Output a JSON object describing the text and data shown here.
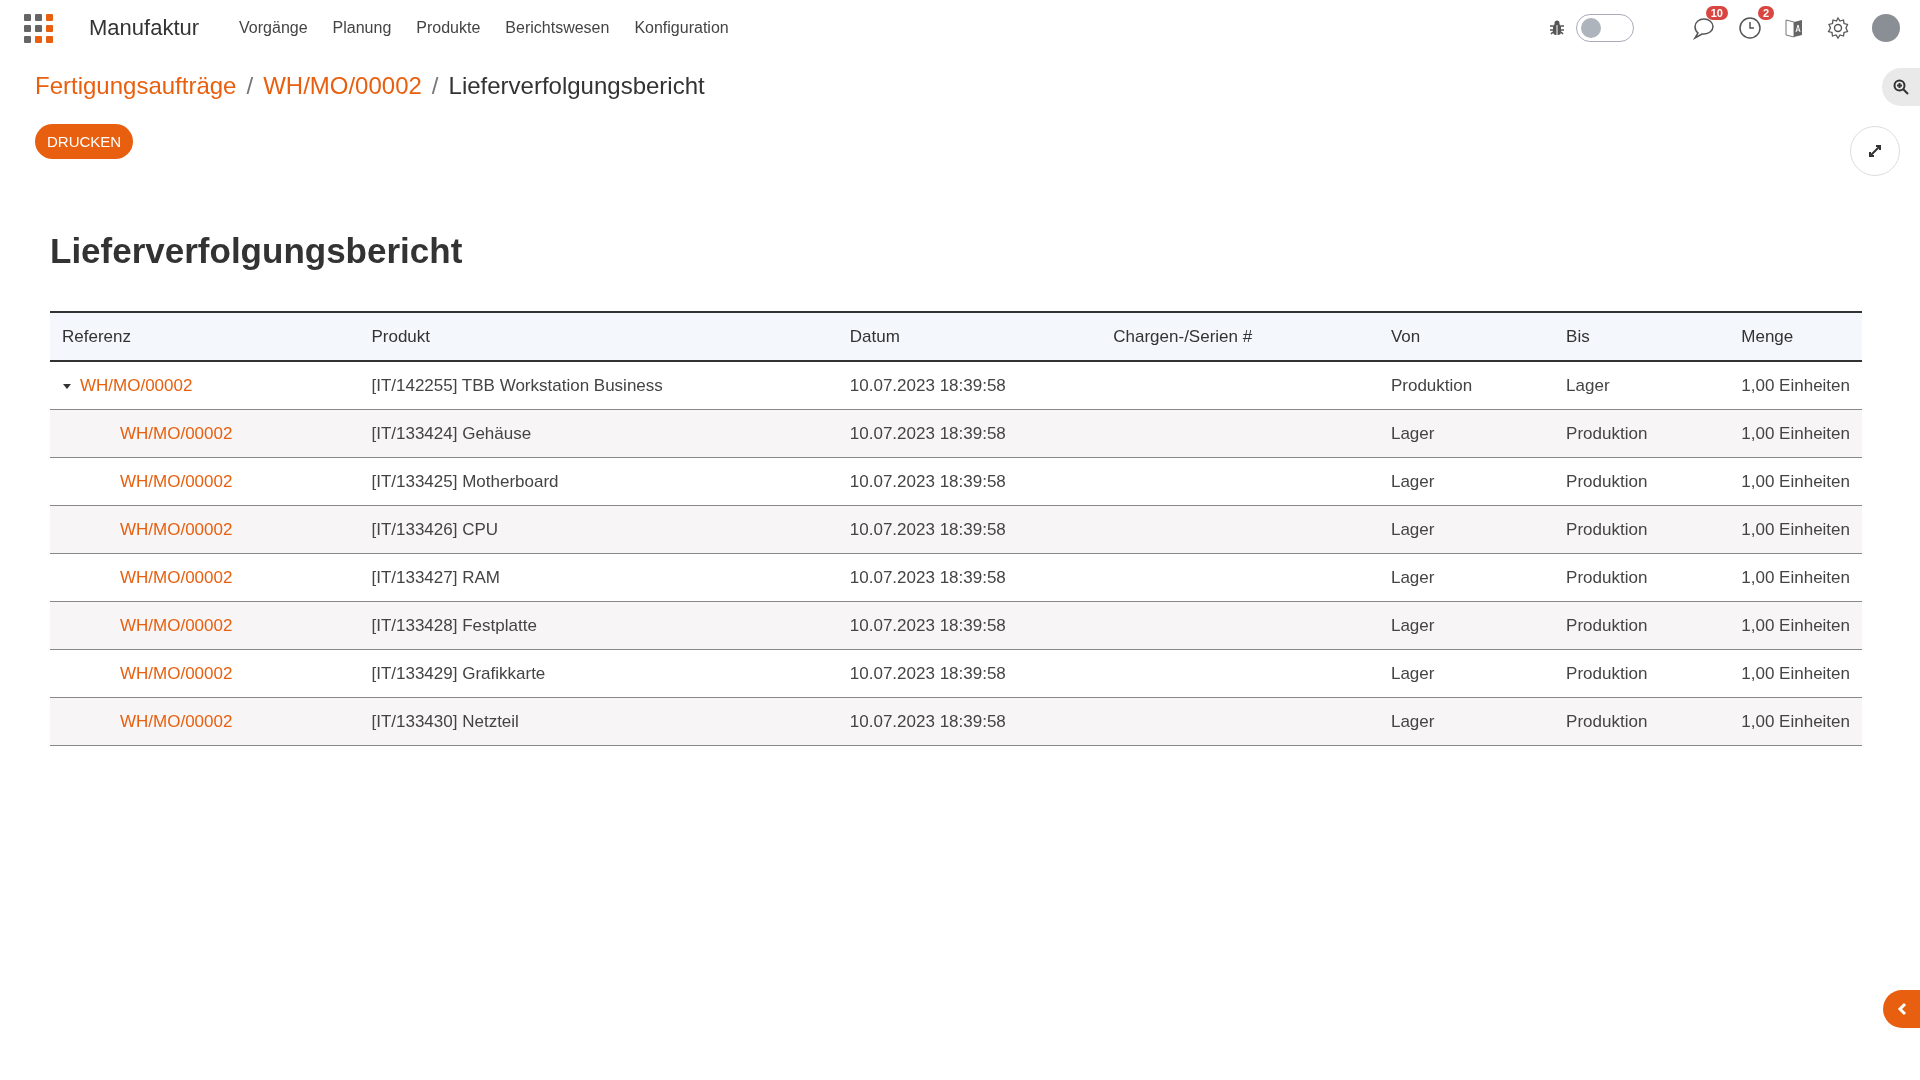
{
  "navbar": {
    "app_name": "Manufaktur",
    "menu": [
      "Vorgänge",
      "Planung",
      "Produkte",
      "Berichtswesen",
      "Konfiguration"
    ],
    "debug_toggle": {
      "on": false
    },
    "messages_badge": "10",
    "activities_badge": "2"
  },
  "breadcrumb": {
    "items": [
      "Fertigungsaufträge",
      "WH/MO/00002",
      "Lieferverfolgungsbericht"
    ],
    "separators": [
      "/",
      "/"
    ]
  },
  "print_button": "DRUCKEN",
  "report": {
    "title": "Lieferverfolgungsbericht",
    "columns": [
      "Referenz",
      "Produkt",
      "Datum",
      "Chargen-/Serien #",
      "Von",
      "Bis",
      "Menge"
    ],
    "rows": [
      {
        "reference": "WH/MO/00002",
        "product": "[IT/142255] TBB Workstation Business",
        "date": "10.07.2023 18:39:58",
        "from": "Produktion",
        "to": "Lager",
        "quantity": "1,00 Einheiten",
        "expanded": true,
        "children": [
          {
            "reference": "WH/MO/00002",
            "product": "[IT/133424] Gehäuse",
            "date": "10.07.2023 18:39:58",
            "from": "Lager",
            "to": "Produktion",
            "quantity": "1,00 Einheiten"
          },
          {
            "reference": "WH/MO/00002",
            "product": "[IT/133425] Motherboard",
            "date": "10.07.2023 18:39:58",
            "from": "Lager",
            "to": "Produktion",
            "quantity": "1,00 Einheiten"
          },
          {
            "reference": "WH/MO/00002",
            "product": "[IT/133426] CPU",
            "date": "10.07.2023 18:39:58",
            "from": "Lager",
            "to": "Produktion",
            "quantity": "1,00 Einheiten"
          },
          {
            "reference": "WH/MO/00002",
            "product": "[IT/133427] RAM",
            "date": "10.07.2023 18:39:58",
            "from": "Lager",
            "to": "Produktion",
            "quantity": "1,00 Einheiten"
          },
          {
            "reference": "WH/MO/00002",
            "product": "[IT/133428] Festplatte",
            "date": "10.07.2023 18:39:58",
            "from": "Lager",
            "to": "Produktion",
            "quantity": "1,00 Einheiten"
          },
          {
            "reference": "WH/MO/00002",
            "product": "[IT/133429] Grafikkarte",
            "date": "10.07.2023 18:39:58",
            "from": "Lager",
            "to": "Produktion",
            "quantity": "1,00 Einheiten"
          },
          {
            "reference": "WH/MO/00002",
            "product": "[IT/133430] Netzteil",
            "date": "10.07.2023 18:39:58",
            "from": "Lager",
            "to": "Produktion",
            "quantity": "1,00 Einheiten"
          }
        ]
      }
    ]
  }
}
